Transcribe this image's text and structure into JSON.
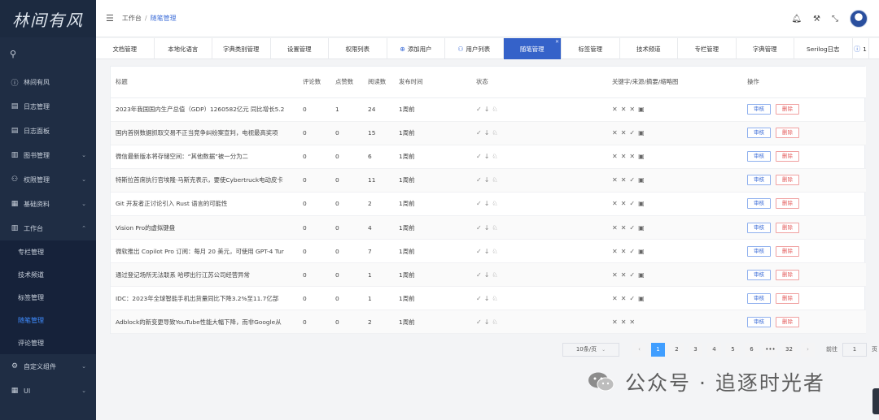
{
  "logo": "林间有风",
  "sidebar": {
    "items": [
      {
        "label": "林间有风",
        "icon": "info-icon",
        "glyph": "ⓘ"
      },
      {
        "label": "日志管理",
        "icon": "document-icon",
        "glyph": "▤"
      },
      {
        "label": "日志面板",
        "icon": "document-icon",
        "glyph": "▤"
      },
      {
        "label": "图书管理",
        "icon": "book-icon",
        "glyph": "▥"
      },
      {
        "label": "权限管理",
        "icon": "user-icon",
        "glyph": "⚇"
      },
      {
        "label": "基础资料",
        "icon": "database-icon",
        "glyph": "▦"
      },
      {
        "label": "工作台",
        "icon": "book-icon",
        "glyph": "▥"
      }
    ],
    "sub_items": [
      "专栏管理",
      "技术频道",
      "标签管理",
      "随笔管理",
      "评论管理"
    ],
    "bottom_items": [
      {
        "label": "自定义组件",
        "icon": "gear-icon",
        "glyph": "⚙"
      },
      {
        "label": "UI",
        "icon": "grid-icon",
        "glyph": "▦"
      }
    ]
  },
  "header": {
    "breadcrumb": [
      "工作台",
      "随笔管理"
    ]
  },
  "tabs": [
    "文档管理",
    "本地化语言",
    "字典类别管理",
    "设置管理",
    "权限列表",
    "添加用户",
    "用户列表",
    "随笔管理",
    "标签管理",
    "技术频道",
    "专栏管理",
    "字典管理",
    "Serilog日志",
    "1"
  ],
  "table": {
    "columns": [
      "标题",
      "评论数",
      "点赞数",
      "阅读数",
      "发布时间",
      "状态",
      "关键字/来源/摘要/缩略图",
      "操作"
    ],
    "rows": [
      {
        "title": "2023年我国国内生产总值（GDP）1260582亿元 同比增长5.2",
        "comments": "0",
        "likes": "1",
        "reads": "24",
        "time": "1周前",
        "kw": [
          "✕",
          "✕",
          "✕",
          "▣"
        ]
      },
      {
        "title": "国内首例数据抓取交易不正当竞争纠纷案宣判，电视最高奖项",
        "comments": "0",
        "likes": "0",
        "reads": "15",
        "time": "1周前",
        "kw": [
          "✕",
          "✕",
          "✓",
          "▣"
        ]
      },
      {
        "title": "微信最新版本将存储空间：“其他数据”被一分为二",
        "comments": "0",
        "likes": "0",
        "reads": "6",
        "time": "1周前",
        "kw": [
          "✕",
          "✕",
          "✕",
          "▣"
        ]
      },
      {
        "title": "特斯拉首席执行官埃隆·马斯克表示，要使Cybertruck电动皮卡",
        "comments": "0",
        "likes": "0",
        "reads": "11",
        "time": "1周前",
        "kw": [
          "✕",
          "✕",
          "✓",
          "▣"
        ]
      },
      {
        "title": "Git 开发者正讨论引入 Rust 语言的可能性",
        "comments": "0",
        "likes": "0",
        "reads": "2",
        "time": "1周前",
        "kw": [
          "✕",
          "✕",
          "✓",
          "▣"
        ]
      },
      {
        "title": "Vision Pro的虚拟键盘",
        "comments": "0",
        "likes": "0",
        "reads": "4",
        "time": "1周前",
        "kw": [
          "✕",
          "✕",
          "✓",
          "▣"
        ]
      },
      {
        "title": "微软推出 Copilot Pro 订阅：每月 20 美元，可使用 GPT-4 Tur",
        "comments": "0",
        "likes": "0",
        "reads": "7",
        "time": "1周前",
        "kw": [
          "✕",
          "✕",
          "✓",
          "▣"
        ]
      },
      {
        "title": "通过登记场所无法联系 哈啰出行江苏公司经营异常",
        "comments": "0",
        "likes": "0",
        "reads": "1",
        "time": "1周前",
        "kw": [
          "✕",
          "✕",
          "✓",
          "▣"
        ]
      },
      {
        "title": "IDC：2023年全球智能手机出货量同比下降3.2%至11.7亿部",
        "comments": "0",
        "likes": "0",
        "reads": "1",
        "time": "1周前",
        "kw": [
          "✕",
          "✕",
          "✓",
          "▣"
        ]
      },
      {
        "title": "Adblock的新变更导致YouTube性能大幅下降，而非Google从",
        "comments": "0",
        "likes": "0",
        "reads": "2",
        "time": "1周前",
        "kw": [
          "✕",
          "✕",
          "✕"
        ]
      }
    ],
    "status_icons": [
      "✓",
      "↓",
      "♘"
    ],
    "audit_label": "审核",
    "delete_label": "删除"
  },
  "pagination": {
    "page_size": "10条/页",
    "pages": [
      "1",
      "2",
      "3",
      "4",
      "5",
      "6",
      "•••",
      "32"
    ],
    "current": "1",
    "goto_label": "前往",
    "goto_value": "1",
    "page_unit": "页"
  },
  "watermark": "公众号 · 追逐时光者",
  "colors": {
    "sidebar": "#1f2d44",
    "accent": "#3562c9",
    "active_page": "#409eff",
    "delete": "#e35b5b"
  }
}
